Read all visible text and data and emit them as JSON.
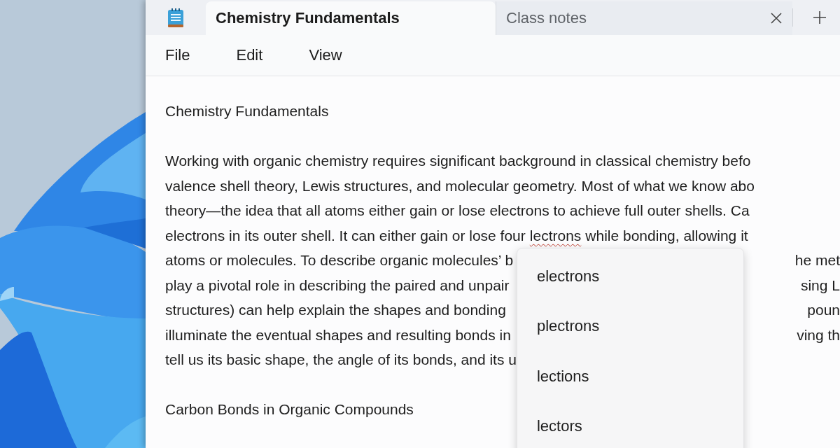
{
  "tabs": [
    {
      "label": "Chemistry Fundamentals",
      "selected": true,
      "closable": false
    },
    {
      "label": "Class notes",
      "selected": false,
      "closable": true
    }
  ],
  "menu": [
    "File",
    "Edit",
    "View"
  ],
  "document": {
    "title": "Chemistry Fundamentals",
    "lines": [
      [
        {
          "text": "Working with organic chemistry requires significant background in classical chemistry befo",
          "misspelled": false
        }
      ],
      [
        {
          "text": "valence shell theory, Lewis structures, and molecular geometry. Most of what we know abo",
          "misspelled": false
        }
      ],
      [
        {
          "text": "theory—the idea that all atoms either gain or lose electrons to achieve full outer shells. Ca",
          "misspelled": false
        }
      ],
      [
        {
          "text": "electrons in its outer shell. It can either gain or lose four",
          "misspelled": false
        },
        {
          "text": "lectrons",
          "misspelled": true
        },
        {
          "text": "while bonding, allowing it",
          "misspelled": false
        }
      ]
    ],
    "covered_lines": [
      {
        "left": "atoms or molecules. To describe organic molecules’ b",
        "right": "he met"
      },
      {
        "left": "play a pivotal role in describing the paired and unpair",
        "right": "sing L"
      },
      {
        "left": "structures) can help explain the shapes and bonding",
        "right": "poun"
      },
      {
        "left": "illuminate the eventual shapes and resulting bonds in",
        "right": "ving th"
      },
      {
        "left": "tell us its basic shape, the angle of its bonds, and its u"
      }
    ],
    "heading": "Carbon Bonds in Organic Compounds"
  },
  "suggestions": [
    "electrons",
    "plectrons",
    "lections",
    "lectors"
  ]
}
